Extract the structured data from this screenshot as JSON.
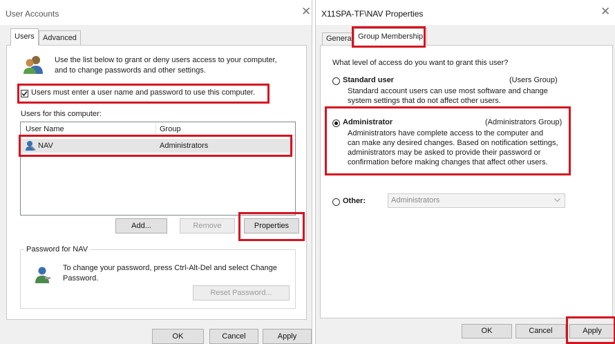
{
  "left": {
    "title": "User Accounts",
    "close": "✕",
    "tabs": [
      "Users",
      "Advanced"
    ],
    "intro_line1": "Use the list below to grant or deny users access to your computer,",
    "intro_line2": "and to change passwords and other settings.",
    "must_enter_label": "Users must enter a user name and password to use this computer.",
    "must_enter_checked": true,
    "users_label": "Users for this computer:",
    "columns": [
      "User Name",
      "Group"
    ],
    "rows": [
      {
        "name": "NAV",
        "group": "Administrators"
      }
    ],
    "buttons": {
      "add": "Add...",
      "remove": "Remove",
      "properties": "Properties"
    },
    "password_group": "Password for NAV",
    "password_line1": "To change your password, press Ctrl-Alt-Del and select Change",
    "password_line2": "Password.",
    "reset_password": "Reset Password...",
    "footer": {
      "ok": "OK",
      "cancel": "Cancel",
      "apply": "Apply"
    }
  },
  "right": {
    "title": "X11SPA-TF\\NAV Properties",
    "close": "✕",
    "tabs": [
      "General",
      "Group Membership"
    ],
    "question": "What level of access do you want to grant this user?",
    "standard": {
      "label": "Standard user",
      "group": "(Users Group)",
      "desc1": "Standard account users can use most software and change",
      "desc2": "system settings that do not affect other users.",
      "selected": false
    },
    "administrator": {
      "label": "Administrator",
      "group": "(Administrators Group)",
      "desc1": "Administrators have complete access to the computer and",
      "desc2": "can make any desired changes. Based on notification settings,",
      "desc3": "administrators may be asked to provide their password or",
      "desc4": "confirmation before making changes that affect other users.",
      "selected": true
    },
    "other": {
      "label": "Other:",
      "value": "Administrators",
      "selected": false
    },
    "footer": {
      "ok": "OK",
      "cancel": "Cancel",
      "apply": "Apply"
    }
  },
  "colors": {
    "highlight": "#d6121f",
    "selection": "#e5e5e5"
  }
}
